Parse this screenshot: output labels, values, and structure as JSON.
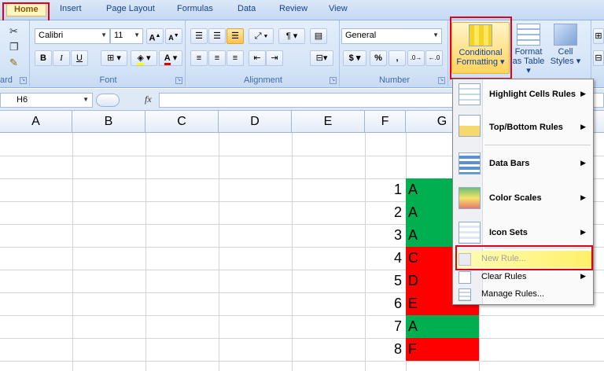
{
  "tabs": [
    "Home",
    "Insert",
    "Page Layout",
    "Formulas",
    "Data",
    "Review",
    "View"
  ],
  "font": {
    "name": "Calibri",
    "size": "11",
    "group_label": "Font"
  },
  "clipboard": {
    "group_label_partial": "ard"
  },
  "alignment": {
    "group_label": "Alignment"
  },
  "number": {
    "format": "General",
    "group_label": "Number",
    "currency": "$",
    "percent": "%",
    "comma": ","
  },
  "styles": {
    "conditional_formatting": [
      "Conditional",
      "Formatting ▾"
    ],
    "format_table": [
      "Format",
      "as Table ▾"
    ],
    "cell_styles": [
      "Cell",
      "Styles ▾"
    ]
  },
  "formula_bar": {
    "cell_ref": "H6",
    "fx": "fx",
    "value": ""
  },
  "columns": [
    "A",
    "B",
    "C",
    "D",
    "E",
    "F",
    "G"
  ],
  "rows": [
    {
      "f": "1",
      "g": "A",
      "color": "#00b050"
    },
    {
      "f": "2",
      "g": "A",
      "color": "#00b050"
    },
    {
      "f": "3",
      "g": "A",
      "color": "#00b050"
    },
    {
      "f": "4",
      "g": "C",
      "color": "#ff0000"
    },
    {
      "f": "5",
      "g": "D",
      "color": "#ff0000"
    },
    {
      "f": "6",
      "g": "E",
      "color": "#ff0000"
    },
    {
      "f": "7",
      "g": "A",
      "color": "#00b050"
    },
    {
      "f": "8",
      "g": "F",
      "color": "#ff0000"
    }
  ],
  "menu": {
    "items": [
      "Highlight Cells Rules",
      "Top/Bottom Rules",
      "Data Bars",
      "Color Scales",
      "Icon Sets"
    ],
    "small_items": [
      "New Rule...",
      "Clear Rules",
      "Manage Rules..."
    ]
  },
  "colors": {
    "highlight_red": "#e0001b",
    "green_fill": "#00b050",
    "red_fill": "#ff0000"
  }
}
